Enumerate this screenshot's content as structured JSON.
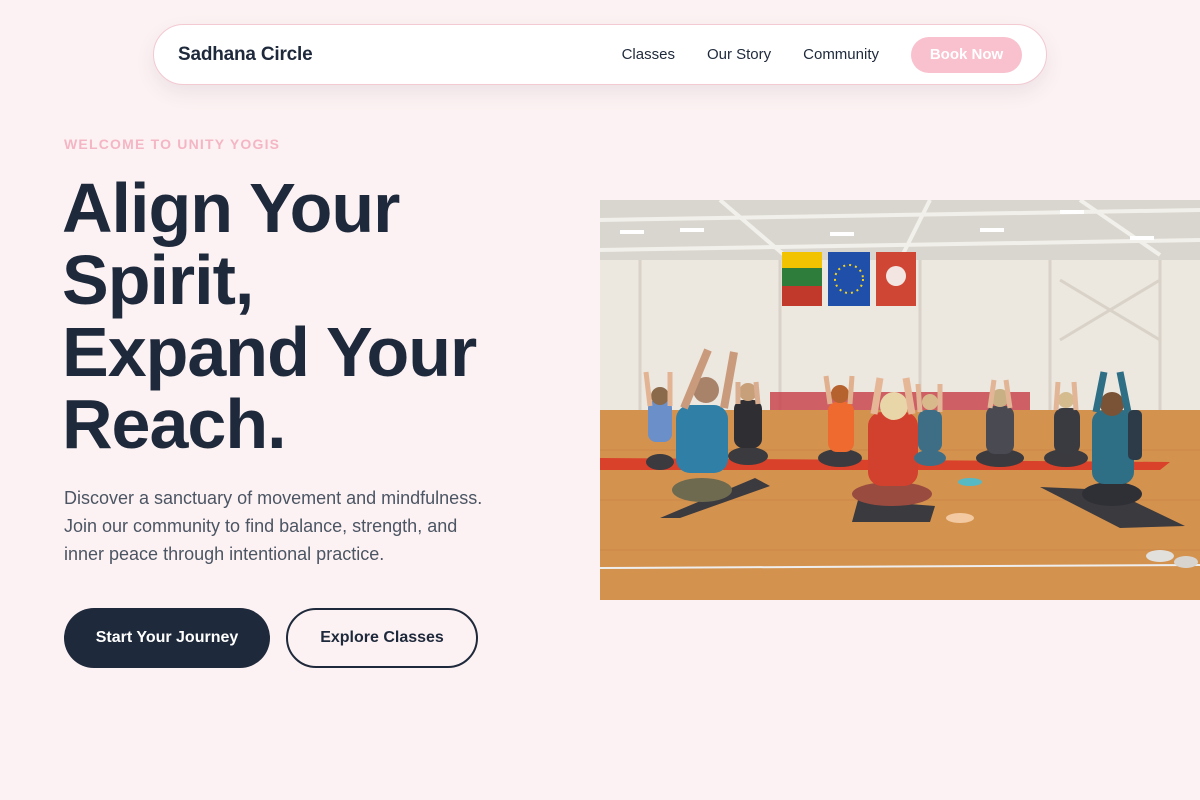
{
  "nav": {
    "brand": "Sadhana Circle",
    "links": [
      "Classes",
      "Our Story",
      "Community"
    ],
    "cta": "Book Now"
  },
  "hero": {
    "eyebrow": "WELCOME TO UNITY YOGIS",
    "headline_lines": [
      "Align Your",
      "Spirit,",
      "Expand Your",
      "Reach."
    ],
    "intro_lines": [
      "Discover a sanctuary of movement and mindfulness.",
      "Join our community to find balance, strength, and",
      "inner peace through intentional practice."
    ],
    "primary_cta": "Start Your Journey",
    "secondary_cta": "Explore Classes",
    "image_alt": "Group yoga class stretching in a gymnasium"
  },
  "colors": {
    "background": "#fdf2f3",
    "navy": "#1e293b",
    "pink": "#f9c0ce",
    "eyebrow_pink": "#f4b5c4"
  }
}
